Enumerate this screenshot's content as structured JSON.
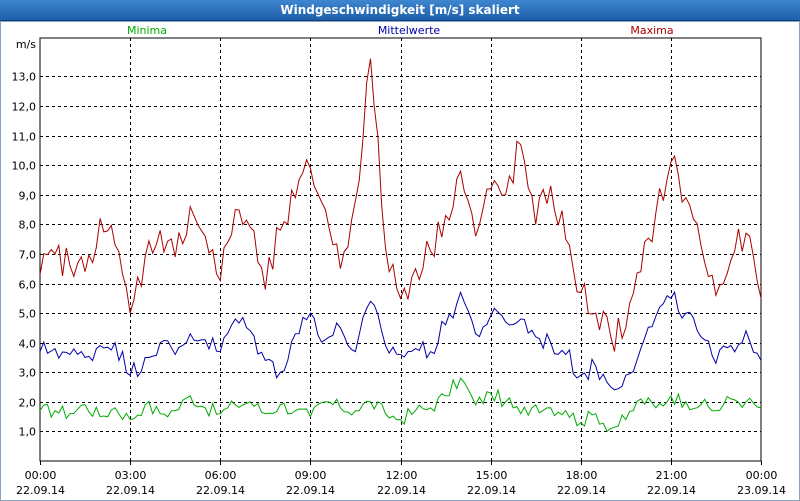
{
  "window": {
    "title": "Windgeschwindigkeit [m/s] skaliert"
  },
  "chart_data": {
    "type": "line",
    "title": "Windgeschwindigkeit [m/s] skaliert",
    "ylabel": "m/s",
    "xlabel": "",
    "ylim": [
      0.0,
      14.3
    ],
    "xlim_hours": [
      0,
      24
    ],
    "grid": true,
    "y_ticks": [
      "1,0",
      "2,0",
      "3,0",
      "4,0",
      "5,0",
      "6,0",
      "7,0",
      "8,0",
      "9,0",
      "10,0",
      "11,0",
      "12,0",
      "13,0"
    ],
    "y_tick_values": [
      1,
      2,
      3,
      4,
      5,
      6,
      7,
      8,
      9,
      10,
      11,
      12,
      13
    ],
    "x_ticks": [
      {
        "hour": 0,
        "time": "00:00",
        "date": "22.09.14"
      },
      {
        "hour": 3,
        "time": "03:00",
        "date": "22.09.14"
      },
      {
        "hour": 6,
        "time": "06:00",
        "date": "22.09.14"
      },
      {
        "hour": 9,
        "time": "09:00",
        "date": "22.09.14"
      },
      {
        "hour": 12,
        "time": "12:00",
        "date": "22.09.14"
      },
      {
        "hour": 15,
        "time": "15:00",
        "date": "22.09.14"
      },
      {
        "hour": 18,
        "time": "18:00",
        "date": "22.09.14"
      },
      {
        "hour": 21,
        "time": "21:00",
        "date": "22.09.14"
      },
      {
        "hour": 24,
        "time": "00:00",
        "date": "23.09.14"
      }
    ],
    "legend": {
      "placement": "top"
    },
    "series": [
      {
        "name": "Minima",
        "color": "#00aa00",
        "x": [
          0,
          0.5,
          1,
          1.5,
          2,
          2.5,
          3,
          3.5,
          4,
          4.5,
          5,
          5.5,
          6,
          6.5,
          7,
          7.5,
          8,
          8.5,
          9,
          9.5,
          10,
          10.5,
          11,
          11.5,
          12,
          12.5,
          13,
          13.5,
          14,
          14.5,
          15,
          15.5,
          16,
          16.5,
          17,
          17.5,
          18,
          18.5,
          19,
          19.5,
          20,
          20.5,
          21,
          21.5,
          22,
          22.5,
          23,
          23.5,
          24
        ],
        "values": [
          1.7,
          1.7,
          1.6,
          1.9,
          1.5,
          1.8,
          1.4,
          1.9,
          1.6,
          1.7,
          2.2,
          1.8,
          1.6,
          1.9,
          2.0,
          1.6,
          1.9,
          1.7,
          1.5,
          2.0,
          1.8,
          1.7,
          2.0,
          1.6,
          1.4,
          1.7,
          1.8,
          2.2,
          2.8,
          1.9,
          2.3,
          2.0,
          1.6,
          1.9,
          1.8,
          1.7,
          1.3,
          1.6,
          1.1,
          1.4,
          2.1,
          1.8,
          2.2,
          2.0,
          1.9,
          1.7,
          2.1,
          2.0,
          1.8
        ]
      },
      {
        "name": "Mittelwerte",
        "color": "#0000aa",
        "x": [
          0,
          0.5,
          1,
          1.5,
          2,
          2.5,
          3,
          3.5,
          4,
          4.5,
          5,
          5.5,
          6,
          6.5,
          7,
          7.5,
          8,
          8.5,
          9,
          9.5,
          10,
          10.5,
          11,
          11.5,
          12,
          12.5,
          13,
          13.5,
          14,
          14.5,
          15,
          15.5,
          16,
          16.5,
          17,
          17.5,
          18,
          18.5,
          19,
          19.5,
          20,
          20.5,
          21,
          21.5,
          22,
          22.5,
          23,
          23.5,
          24
        ],
        "values": [
          3.7,
          3.8,
          3.6,
          3.5,
          3.9,
          4.0,
          2.9,
          3.5,
          4.0,
          3.6,
          4.3,
          4.1,
          3.7,
          4.8,
          4.4,
          3.4,
          3.0,
          4.3,
          5.0,
          4.1,
          4.5,
          3.7,
          5.4,
          3.9,
          3.6,
          3.8,
          3.7,
          4.6,
          5.7,
          4.3,
          4.9,
          4.7,
          4.8,
          4.2,
          4.0,
          3.6,
          2.9,
          3.2,
          2.5,
          2.9,
          3.8,
          4.9,
          5.5,
          5.0,
          4.2,
          3.3,
          3.9,
          4.4,
          3.4
        ]
      },
      {
        "name": "Maxima",
        "color": "#aa0000",
        "x": [
          0,
          0.5,
          1,
          1.5,
          2,
          2.5,
          3,
          3.5,
          4,
          4.5,
          5,
          5.5,
          6,
          6.5,
          7,
          7.5,
          8,
          8.5,
          9,
          9.5,
          10,
          10.5,
          11,
          11.5,
          12,
          12.5,
          13,
          13.5,
          14,
          14.5,
          15,
          15.5,
          16,
          16.5,
          17,
          17.5,
          18,
          18.5,
          19,
          19.5,
          20,
          20.5,
          21,
          21.5,
          22,
          22.5,
          23,
          23.5,
          24
        ],
        "values": [
          6.3,
          7.0,
          6.6,
          6.4,
          8.2,
          7.3,
          5.0,
          6.9,
          7.8,
          6.9,
          8.6,
          7.6,
          6.1,
          8.5,
          7.9,
          5.8,
          7.8,
          8.9,
          9.9,
          8.5,
          6.5,
          8.8,
          13.6,
          7.2,
          5.5,
          6.5,
          7.1,
          8.3,
          9.8,
          7.6,
          9.2,
          9.0,
          10.7,
          8.0,
          9.3,
          7.5,
          5.7,
          5.0,
          4.2,
          4.5,
          6.4,
          8.4,
          10.1,
          8.9,
          7.3,
          5.6,
          6.8,
          7.7,
          5.5
        ]
      }
    ]
  }
}
